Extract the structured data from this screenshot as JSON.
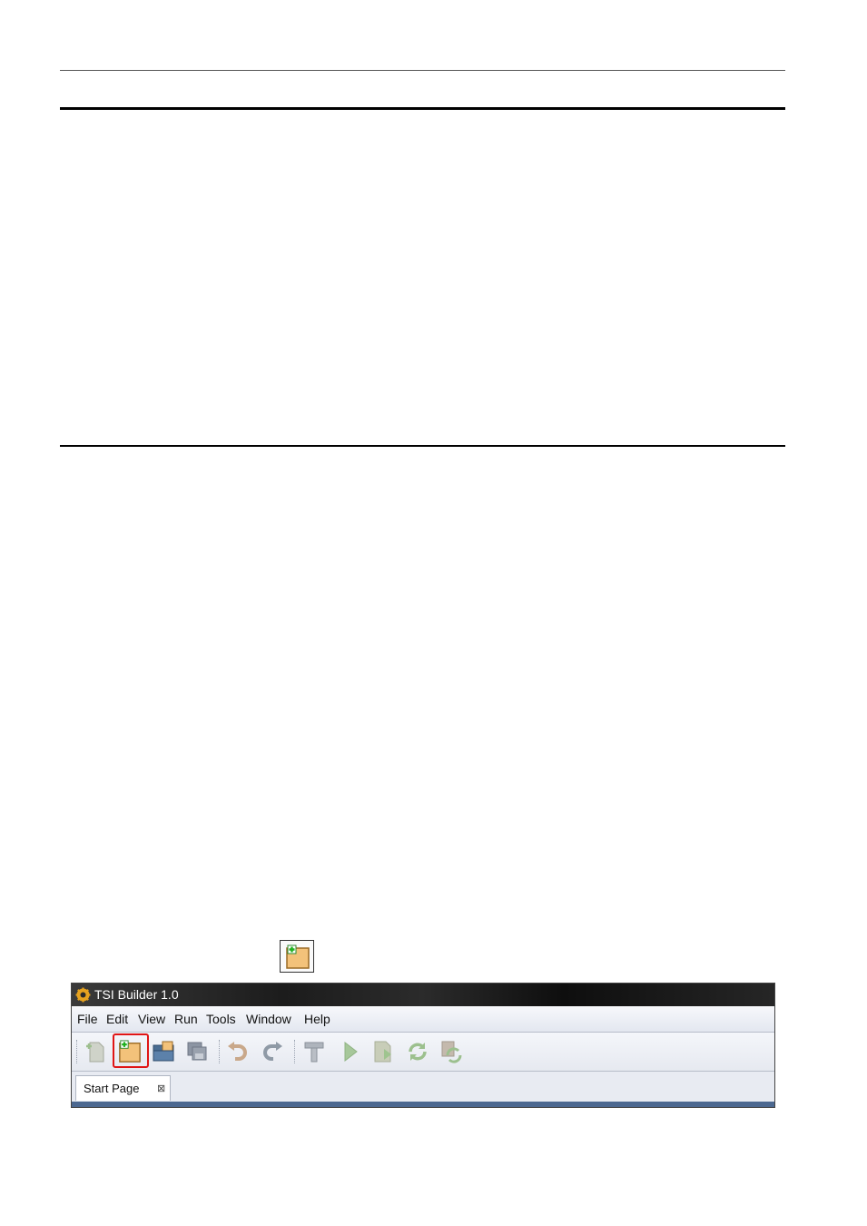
{
  "app": {
    "title": "TSI Builder 1.0",
    "menu": [
      "File",
      "Edit",
      "View",
      "Run",
      "Tools",
      "Window",
      "Help"
    ],
    "toolbar": [
      {
        "name": "new-file-icon",
        "enabled": false
      },
      {
        "name": "new-project-icon",
        "enabled": true,
        "highlighted": true
      },
      {
        "name": "open-project-icon",
        "enabled": true
      },
      {
        "name": "save-all-icon",
        "enabled": false
      },
      {
        "name": "undo-icon",
        "enabled": false
      },
      {
        "name": "redo-icon",
        "enabled": false
      },
      {
        "name": "build-hammer-icon",
        "enabled": false
      },
      {
        "name": "run-icon",
        "enabled": false
      },
      {
        "name": "deploy-icon",
        "enabled": false
      },
      {
        "name": "refresh-icon",
        "enabled": false
      },
      {
        "name": "sync-icon",
        "enabled": false
      }
    ],
    "tabs": [
      {
        "label": "Start Page",
        "close_glyph": "⊠"
      }
    ]
  },
  "colors": {
    "highlight": "#e01515",
    "titlebar": "#1c1c1c",
    "tab_strip": "#4c6890",
    "folder": "#f3c27a"
  }
}
